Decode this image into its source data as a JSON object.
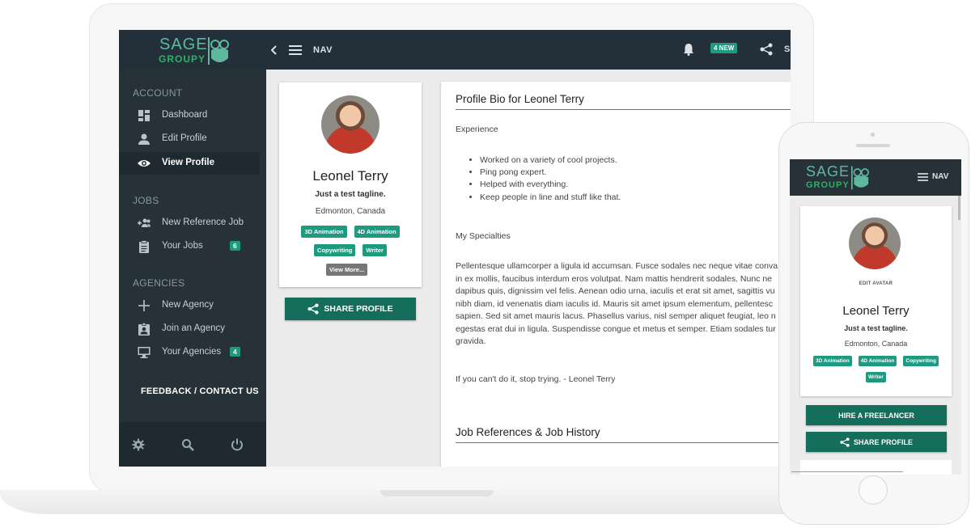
{
  "laptop": {
    "brand": {
      "sage": "SAGE",
      "groupy": "GROUPY"
    },
    "topbar": {
      "nav_label": "NAV",
      "new_badge": "4 NEW",
      "cut_text": "S"
    },
    "sidebar": {
      "sections": [
        {
          "title": "ACCOUNT",
          "items": [
            {
              "label": "Dashboard",
              "icon": "dashboard-icon"
            },
            {
              "label": "Edit Profile",
              "icon": "person-icon"
            },
            {
              "label": "View Profile",
              "icon": "eye-icon",
              "active": true
            }
          ]
        },
        {
          "title": "JOBS",
          "items": [
            {
              "label": "New Reference Job",
              "icon": "add-group-icon"
            },
            {
              "label": "Your Jobs",
              "icon": "clipboard-icon",
              "count": "6"
            }
          ]
        },
        {
          "title": "AGENCIES",
          "items": [
            {
              "label": "New Agency",
              "icon": "plus-icon"
            },
            {
              "label": "Join an Agency",
              "icon": "badge-icon"
            },
            {
              "label": "Your Agencies",
              "icon": "monitor-icon",
              "count": "4"
            }
          ]
        }
      ],
      "feedback": "FEEDBACK / CONTACT US",
      "footer_icons": [
        "gear-icon",
        "search-icon",
        "power-icon"
      ]
    },
    "profile": {
      "name": "Leonel Terry",
      "tagline": "Just a test tagline.",
      "location": "Edmonton, Canada",
      "skills": [
        "3D Animation",
        "4D Animation",
        "Copywriting",
        "Writer"
      ],
      "view_more": "View More...",
      "share_button": "SHARE PROFILE"
    },
    "bio": {
      "title": "Profile Bio for Leonel Terry",
      "experience_label": "Experience",
      "experience_items": [
        "Worked on a variety of cool projects.",
        "Ping pong expert.",
        "Helped with everything.",
        "Keep people in line and stuff like that."
      ],
      "specialties_label": "My Specialties",
      "lorem_lines": [
        "Pellentesque ullamcorper a ligula id accumsan. Fusce sodales nec neque vitae conva",
        "in ex mollis, faucibus interdum eros volutpat. Nam mattis hendrerit sodales. Nunc ne",
        "dapibus quis, dignissim vel felis. Aenean odio urna, iaculis et erat sit amet, sagittis vu",
        "nibh diam, id venenatis diam iaculis id. Mauris sit amet ipsum elementum, pellentesc",
        "sapien. Sed sit amet mauris lacus. Phasellus varius, nisl semper aliquet feugiat, leo n",
        "egestas erat dui in ligula. Suspendisse congue et metus et semper. Etiam sodales tur",
        "gravida."
      ],
      "quote": "If you can't do it, stop trying. - Leonel Terry",
      "jobs_title": "Job References & Job History"
    }
  },
  "phone": {
    "brand": {
      "sage": "SAGE",
      "groupy": "GROUPY"
    },
    "nav_label": "NAV",
    "edit_avatar": "EDIT AVATAR",
    "name": "Leonel Terry",
    "tagline": "Just a test tagline.",
    "location": "Edmonton, Canada",
    "skills": [
      "3D Animation",
      "4D Animation",
      "Copywriting",
      "Writer"
    ],
    "hire_button": "HIRE A FREELANCER",
    "share_button": "SHARE PROFILE"
  },
  "colors": {
    "sidebar": "#263238",
    "accent": "#1d9a80",
    "button": "#156e5b",
    "brand_green": "#28b463"
  }
}
